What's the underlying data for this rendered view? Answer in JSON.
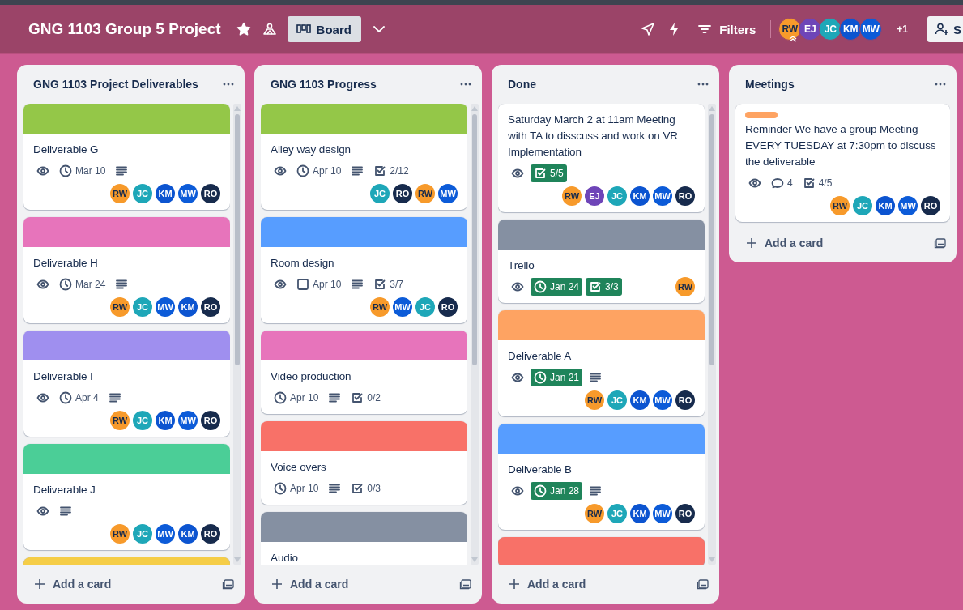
{
  "header": {
    "title": "GNG 1103 Group 5 Project",
    "starred": true,
    "view_button": "Board",
    "filter_button": "Filters",
    "members": [
      {
        "initials": "RW",
        "color": "#f79a2b",
        "admin": true
      },
      {
        "initials": "EJ",
        "color": "#6e45b8",
        "admin": false
      },
      {
        "initials": "JC",
        "color": "#1ea7b8",
        "admin": false
      },
      {
        "initials": "KM",
        "color": "#0c54d0",
        "admin": false
      },
      {
        "initials": "MW",
        "color": "#0c5bd8",
        "admin": false
      }
    ],
    "extra_members": "+1",
    "share_button": "S"
  },
  "lists": [
    {
      "title": "GNG 1103 Project Deliverables",
      "scrollbar": true,
      "add_card": "Add a card",
      "cards": [
        {
          "cover": {
            "color": "#94c748"
          },
          "title": "Deliverable G",
          "badges": [
            {
              "kind": "watch"
            },
            {
              "kind": "due",
              "text": "Mar 10",
              "complete": false
            },
            {
              "kind": "description"
            }
          ],
          "members": [
            {
              "initials": "RW",
              "color": "#f79a2b"
            },
            {
              "initials": "JC",
              "color": "#1ea7b8"
            },
            {
              "initials": "KM",
              "color": "#0c54d0"
            },
            {
              "initials": "MW",
              "color": "#0c5bd8"
            },
            {
              "initials": "RO",
              "color": "#172b4d"
            }
          ]
        },
        {
          "cover": {
            "color": "#e774bb"
          },
          "title": "Deliverable H",
          "badges": [
            {
              "kind": "watch"
            },
            {
              "kind": "due",
              "text": "Mar 24",
              "complete": false
            },
            {
              "kind": "description"
            }
          ],
          "members": [
            {
              "initials": "RW",
              "color": "#f79a2b"
            },
            {
              "initials": "JC",
              "color": "#1ea7b8"
            },
            {
              "initials": "MW",
              "color": "#0c5bd8"
            },
            {
              "initials": "KM",
              "color": "#0c54d0"
            },
            {
              "initials": "RO",
              "color": "#172b4d"
            }
          ]
        },
        {
          "cover": {
            "color": "#9f8fef"
          },
          "title": "Deliverable I",
          "badges": [
            {
              "kind": "watch"
            },
            {
              "kind": "due",
              "text": "Apr 4",
              "complete": false
            },
            {
              "kind": "description"
            }
          ],
          "members": [
            {
              "initials": "RW",
              "color": "#f79a2b"
            },
            {
              "initials": "JC",
              "color": "#1ea7b8"
            },
            {
              "initials": "KM",
              "color": "#0c54d0"
            },
            {
              "initials": "MW",
              "color": "#0c5bd8"
            },
            {
              "initials": "RO",
              "color": "#172b4d"
            }
          ]
        },
        {
          "cover": {
            "color": "#4bce97"
          },
          "title": "Deliverable J",
          "badges": [
            {
              "kind": "watch"
            },
            {
              "kind": "description"
            }
          ],
          "members": [
            {
              "initials": "RW",
              "color": "#f79a2b"
            },
            {
              "initials": "JC",
              "color": "#1ea7b8"
            },
            {
              "initials": "MW",
              "color": "#0c5bd8"
            },
            {
              "initials": "KM",
              "color": "#0c54d0"
            },
            {
              "initials": "RO",
              "color": "#172b4d"
            }
          ]
        },
        {
          "cover": {
            "color": "#f5cd47"
          }
        }
      ]
    },
    {
      "title": "GNG 1103 Progress",
      "scrollbar": true,
      "add_card": "Add a card",
      "cards": [
        {
          "cover": {
            "color": "#94c748"
          },
          "title": "Alley way design",
          "badges": [
            {
              "kind": "watch"
            },
            {
              "kind": "due",
              "text": "Apr 10",
              "complete": false
            },
            {
              "kind": "description"
            },
            {
              "kind": "checklist",
              "text": "2/12",
              "complete": false
            }
          ],
          "members": [
            {
              "initials": "JC",
              "color": "#1ea7b8"
            },
            {
              "initials": "RO",
              "color": "#172b4d"
            },
            {
              "initials": "RW",
              "color": "#f79a2b"
            },
            {
              "initials": "MW",
              "color": "#0c5bd8"
            }
          ]
        },
        {
          "cover": {
            "color": "#579dff"
          },
          "title": "Room design",
          "badges": [
            {
              "kind": "watch"
            },
            {
              "kind": "duebox",
              "text": "Apr 10",
              "complete": false
            },
            {
              "kind": "description"
            },
            {
              "kind": "checklist",
              "text": "3/7",
              "complete": false
            }
          ],
          "members": [
            {
              "initials": "RW",
              "color": "#f79a2b"
            },
            {
              "initials": "MW",
              "color": "#0c5bd8"
            },
            {
              "initials": "JC",
              "color": "#1ea7b8"
            },
            {
              "initials": "RO",
              "color": "#172b4d"
            }
          ]
        },
        {
          "cover": {
            "color": "#e774bb"
          },
          "title": "Video production",
          "badges": [
            {
              "kind": "due",
              "text": "Apr 10",
              "complete": false
            },
            {
              "kind": "description"
            },
            {
              "kind": "checklist",
              "text": "0/2",
              "complete": false
            }
          ]
        },
        {
          "cover": {
            "color": "#f87168"
          },
          "title": "Voice overs",
          "badges": [
            {
              "kind": "due",
              "text": "Apr 10",
              "complete": false
            },
            {
              "kind": "description"
            },
            {
              "kind": "checklist",
              "text": "0/3",
              "complete": false
            }
          ]
        },
        {
          "cover": {
            "color": "#8590a2"
          },
          "title": "Audio"
        }
      ]
    },
    {
      "title": "Done",
      "scrollbar": true,
      "add_card": "Add a card",
      "cards": [
        {
          "title": "Saturday March 2 at 11am Meeting with TA to disscuss and work on VR Implementation",
          "badges": [
            {
              "kind": "watch"
            },
            {
              "kind": "checklist",
              "text": "5/5",
              "complete": true
            }
          ],
          "members": [
            {
              "initials": "RW",
              "color": "#f79a2b"
            },
            {
              "initials": "EJ",
              "color": "#6e45b8"
            },
            {
              "initials": "JC",
              "color": "#1ea7b8"
            },
            {
              "initials": "KM",
              "color": "#0c54d0"
            },
            {
              "initials": "MW",
              "color": "#0c5bd8"
            },
            {
              "initials": "RO",
              "color": "#172b4d"
            }
          ]
        },
        {
          "cover": {
            "color": "#8590a2"
          },
          "title": "Trello",
          "inline_members": true,
          "badges": [
            {
              "kind": "watch"
            },
            {
              "kind": "due",
              "text": "Jan 24",
              "complete": true
            },
            {
              "kind": "checklist",
              "text": "3/3",
              "complete": true
            }
          ],
          "members": [
            {
              "initials": "RW",
              "color": "#f79a2b"
            }
          ]
        },
        {
          "cover": {
            "color": "#fea362"
          },
          "title": "Deliverable A",
          "badges": [
            {
              "kind": "watch"
            },
            {
              "kind": "due",
              "text": "Jan 21",
              "complete": true
            },
            {
              "kind": "description"
            }
          ],
          "members": [
            {
              "initials": "RW",
              "color": "#f79a2b"
            },
            {
              "initials": "JC",
              "color": "#1ea7b8"
            },
            {
              "initials": "KM",
              "color": "#0c54d0"
            },
            {
              "initials": "MW",
              "color": "#0c5bd8"
            },
            {
              "initials": "RO",
              "color": "#172b4d"
            }
          ]
        },
        {
          "cover": {
            "color": "#579dff"
          },
          "title": "Deliverable B",
          "badges": [
            {
              "kind": "watch"
            },
            {
              "kind": "due",
              "text": "Jan 28",
              "complete": true
            },
            {
              "kind": "description"
            }
          ],
          "members": [
            {
              "initials": "RW",
              "color": "#f79a2b"
            },
            {
              "initials": "JC",
              "color": "#1ea7b8"
            },
            {
              "initials": "KM",
              "color": "#0c54d0"
            },
            {
              "initials": "MW",
              "color": "#0c5bd8"
            },
            {
              "initials": "RO",
              "color": "#172b4d"
            }
          ]
        },
        {
          "cover": {
            "color": "#f87168"
          }
        }
      ]
    },
    {
      "title": "Meetings",
      "scrollbar": false,
      "add_card": "Add a card",
      "cards": [
        {
          "label": {
            "color": "#fea362"
          },
          "title": "Reminder We have a group Meeting EVERY TUESDAY at 7:30pm to discuss the deliverable",
          "badges": [
            {
              "kind": "watch"
            },
            {
              "kind": "comments",
              "text": "4"
            },
            {
              "kind": "checklist",
              "text": "4/5",
              "complete": false
            }
          ],
          "members": [
            {
              "initials": "RW",
              "color": "#f79a2b"
            },
            {
              "initials": "JC",
              "color": "#1ea7b8"
            },
            {
              "initials": "KM",
              "color": "#0c54d0"
            },
            {
              "initials": "MW",
              "color": "#0c5bd8"
            },
            {
              "initials": "RO",
              "color": "#172b4d"
            }
          ]
        }
      ]
    }
  ]
}
